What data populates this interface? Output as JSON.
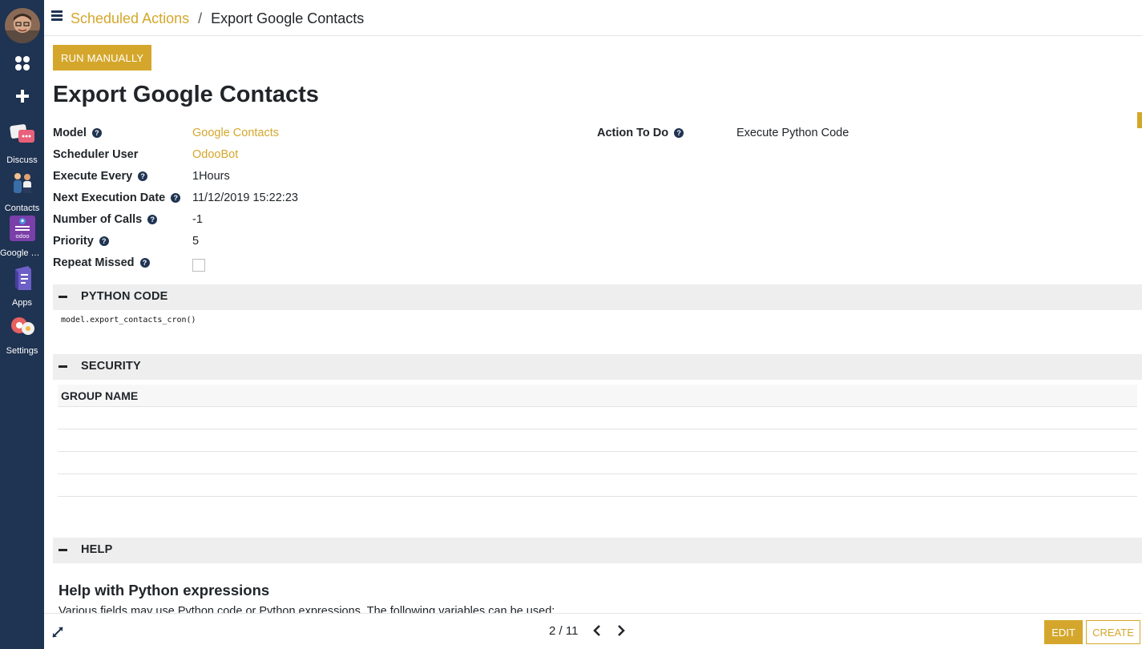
{
  "sidebar": {
    "apps": [
      {
        "label": "Discuss",
        "icon": "discuss-icon"
      },
      {
        "label": "Contacts",
        "icon": "contacts-icon"
      },
      {
        "label": "Google C...",
        "icon": "google-contacts-icon"
      },
      {
        "label": "Apps",
        "icon": "apps-icon"
      },
      {
        "label": "Settings",
        "icon": "settings-icon"
      }
    ]
  },
  "breadcrumb": {
    "parent": "Scheduled Actions",
    "separator": "/",
    "current": "Export Google Contacts"
  },
  "toolbar": {
    "run_manually": "RUN MANUALLY"
  },
  "record": {
    "title": "Export Google Contacts",
    "fields": {
      "model": {
        "label": "Model",
        "value": "Google Contacts"
      },
      "scheduler_user": {
        "label": "Scheduler User",
        "value": "OdooBot"
      },
      "execute_every": {
        "label": "Execute Every",
        "value": "1Hours"
      },
      "next_execution_date": {
        "label": "Next Execution Date",
        "value": "11/12/2019 15:22:23"
      },
      "number_of_calls": {
        "label": "Number of Calls",
        "value": "-1"
      },
      "priority": {
        "label": "Priority",
        "value": "5"
      },
      "repeat_missed": {
        "label": "Repeat Missed",
        "checked": false
      },
      "action_to_do": {
        "label": "Action To Do",
        "value": "Execute Python Code"
      }
    }
  },
  "sections": {
    "python_code": {
      "title": "PYTHON CODE",
      "code": "model.export_contacts_cron()"
    },
    "security": {
      "title": "SECURITY",
      "column": "GROUP NAME"
    },
    "help": {
      "title": "HELP",
      "heading": "Help with Python expressions",
      "text": "Various fields may use Python code or Python expressions. The following variables can be used:"
    }
  },
  "pager": {
    "value": "2 / 11"
  },
  "footer": {
    "edit": "EDIT",
    "create": "CREATE"
  },
  "colors": {
    "accent": "#d4a72c",
    "sidebar": "#1f3352"
  }
}
